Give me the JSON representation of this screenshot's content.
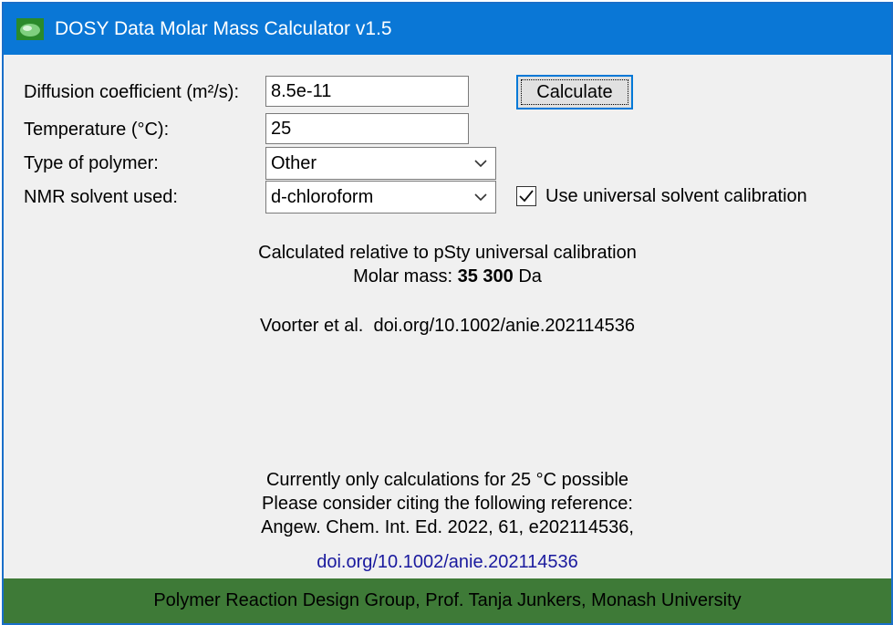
{
  "window": {
    "title": "DOSY Data Molar Mass Calculator v1.5",
    "title_bar_color": "#0a77d6",
    "footer_color": "#3e7a37"
  },
  "form": {
    "diffusion_label": "Diffusion coefficient (m²/s):",
    "diffusion_value": "8.5e-11",
    "temperature_label": "Temperature (°C):",
    "temperature_value": "25",
    "polymer_label": "Type of polymer:",
    "polymer_selected": "Other",
    "solvent_label": "NMR solvent used:",
    "solvent_selected": "d-chloroform",
    "calculate_label": "Calculate",
    "universal_calibration_label": "Use universal solvent calibration",
    "universal_calibration_checked": true
  },
  "result": {
    "calibration_text": "Calculated relative to pSty universal calibration",
    "molar_mass_prefix": "Molar mass:",
    "molar_mass_value": "35 300",
    "molar_mass_unit": "Da",
    "reference_short": "Voorter et al.  doi.org/10.1002/anie.202114536"
  },
  "notes": {
    "line1": "Currently only calculations for 25 °C possible",
    "line2": "Please consider citing the following reference:",
    "line3": "Angew. Chem. Int. Ed. 2022, 61, e202114536,",
    "doi_link": "doi.org/10.1002/anie.202114536"
  },
  "footer": {
    "text": "Polymer Reaction Design Group, Prof. Tanja Junkers, Monash University"
  },
  "icons": {
    "app": "app-icon",
    "dropdown": "chevron-down-icon",
    "check": "checkmark-icon"
  }
}
